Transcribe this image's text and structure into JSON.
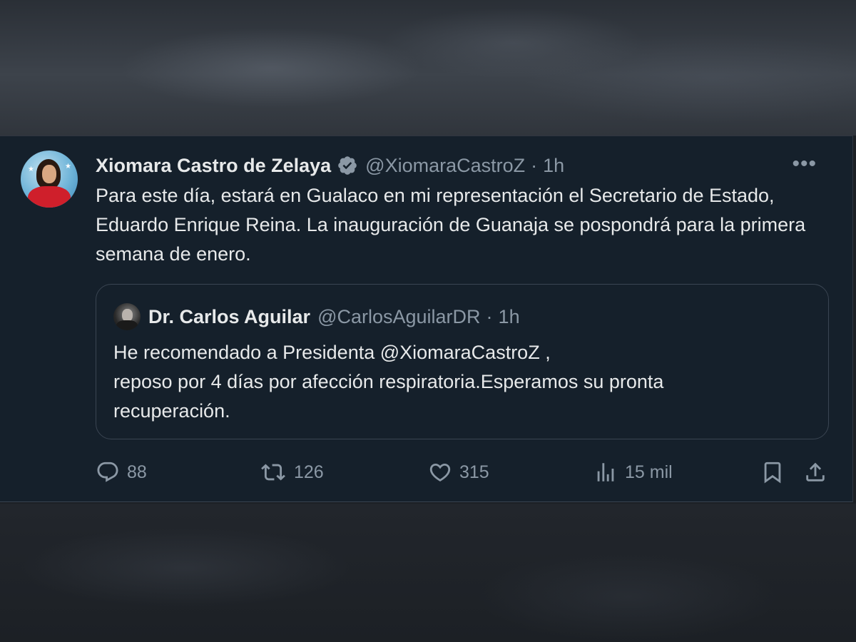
{
  "tweet": {
    "author_name": "Xiomara Castro de Zelaya",
    "handle": "@XiomaraCastroZ",
    "separator": "·",
    "time": "1h",
    "more_label": "•••",
    "text": "Para este día, estará en Gualaco en mi representación el Secretario de Estado, Eduardo Enrique Reina. La inauguración de Guanaja se pospondrá para la primera semana de enero."
  },
  "quote": {
    "author_name": "Dr. Carlos Aguilar",
    "handle": "@CarlosAguilarDR",
    "separator": "·",
    "time": "1h",
    "lines": [
      "He recomendado a Presidenta @XiomaraCastroZ ,",
      "reposo por 4 días por afección respiratoria.Esperamos su pronta",
      "recuperación."
    ]
  },
  "actions": {
    "replies": "88",
    "reposts": "126",
    "likes": "315",
    "views": "15 mil"
  },
  "icons": {
    "verified": "verified-badge-icon",
    "reply": "reply-icon",
    "repost": "repost-icon",
    "like": "heart-icon",
    "views": "views-icon",
    "bookmark": "bookmark-icon",
    "share": "share-icon",
    "more": "more-icon"
  },
  "colors": {
    "background": "#15202b",
    "text_primary": "#e7e9ea",
    "text_secondary": "#8b98a5",
    "border": "#3a4552",
    "verified_badge": "#8b98a5"
  }
}
